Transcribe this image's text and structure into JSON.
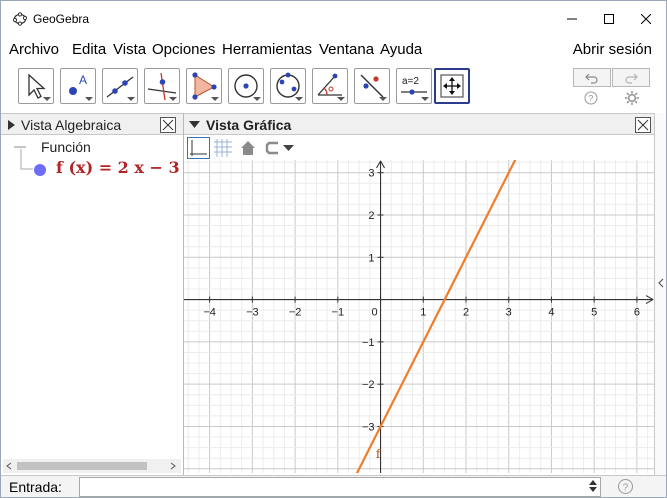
{
  "window": {
    "title": "GeoGebra"
  },
  "menu": {
    "items": [
      "Archivo",
      "Edita",
      "Vista",
      "Opciones",
      "Herramientas",
      "Ventana",
      "Ayuda"
    ],
    "login": "Abrir sesión"
  },
  "toolbar": {
    "tools": [
      "move",
      "point",
      "line",
      "perpendicular-line",
      "polygon",
      "circle-center-point",
      "circle-three-points",
      "angle",
      "reflect-line",
      "slider",
      "move-graphics-view"
    ],
    "equation_icon_text": "a=2"
  },
  "algebra": {
    "title": "Vista Algebraica",
    "group_label": "Función",
    "function_text": "f (x)  =  2 x − 3",
    "function_color": "#6c6cf6"
  },
  "graphics": {
    "title": "Vista Gráfica",
    "x_ticks": [
      "−4",
      "−3",
      "−2",
      "−1",
      "0",
      "1",
      "2",
      "3",
      "4",
      "5",
      "6"
    ],
    "y_ticks": [
      "3",
      "2",
      "1",
      "−1",
      "−2",
      "−3"
    ],
    "function_label": "f",
    "line_color": "#f07d2a"
  },
  "chart_data": {
    "type": "line",
    "series": [
      {
        "name": "f",
        "formula": "2x - 3",
        "x": [
          -1,
          0,
          1,
          1.5,
          2,
          3,
          4
        ],
        "y": [
          -5,
          -3,
          -1,
          0,
          1,
          3,
          5
        ]
      }
    ],
    "xlim": [
      -4.6,
      6.4
    ],
    "ylim": [
      -4.1,
      3.3
    ],
    "grid": true
  },
  "input": {
    "label": "Entrada:",
    "value": ""
  }
}
